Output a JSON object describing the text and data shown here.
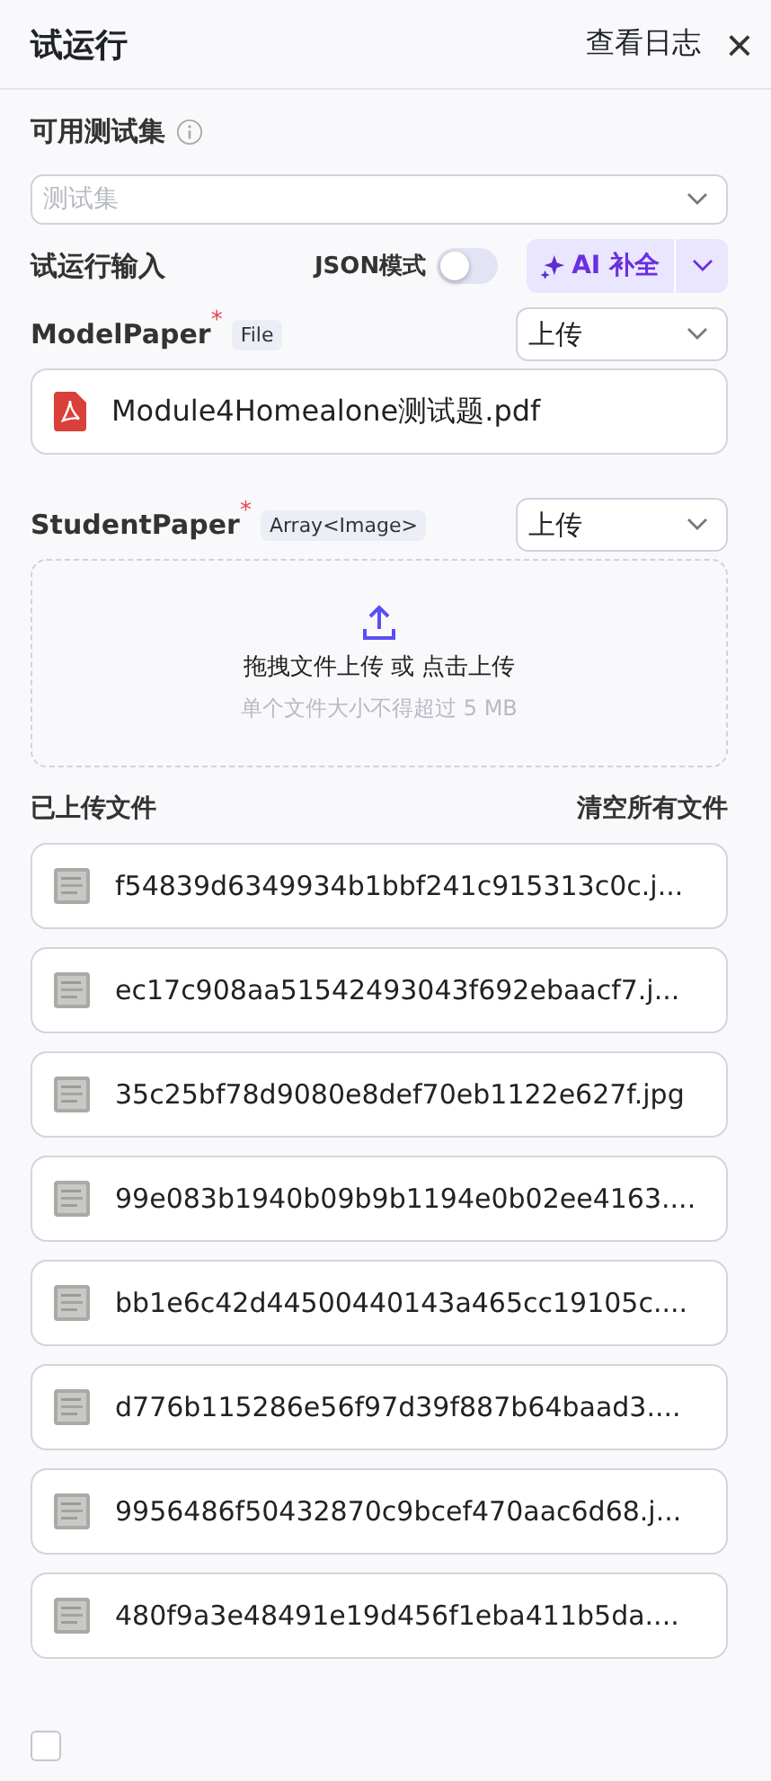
{
  "header": {
    "title": "试运行",
    "log_link": "查看日志",
    "close": "×"
  },
  "test_set": {
    "label": "可用测试集",
    "placeholder": "测试集"
  },
  "run_input": {
    "label": "试运行输入",
    "json_mode": {
      "label": "JSON模式",
      "on": false
    },
    "ai_button": "AI 补全"
  },
  "fields": [
    {
      "kind": "file",
      "name": "ModelPaper",
      "required_mark": "*",
      "type": "File",
      "mode": "上传",
      "file": "Module4Homealone测试题.pdf"
    },
    {
      "kind": "upload",
      "name": "StudentPaper",
      "required_mark": "*",
      "type": "Array<Image>",
      "mode": "上传",
      "drop_text": "拖拽文件上传 或 点击上传",
      "hint": "单个文件大小不得超过 5 MB"
    }
  ],
  "uploaded": {
    "label": "已上传文件",
    "clear": "清空所有文件",
    "files": [
      "f54839d6349934b1bbf241c915313c0c.j...",
      "ec17c908aa51542493043f692ebaacf7.j...",
      "35c25bf78d9080e8def70eb1122e627f.jpg",
      "99e083b1940b09b9b1194e0b02ee4163....",
      "bb1e6c42d44500440143a465cc19105c....",
      "d776b115286e56f97d39f887b64baad3....",
      "9956486f50432870c9bcef470aac6d68.j...",
      "480f9a3e48491e19d456f1eba411b5da...."
    ]
  },
  "footer": {
    "checked": false
  }
}
